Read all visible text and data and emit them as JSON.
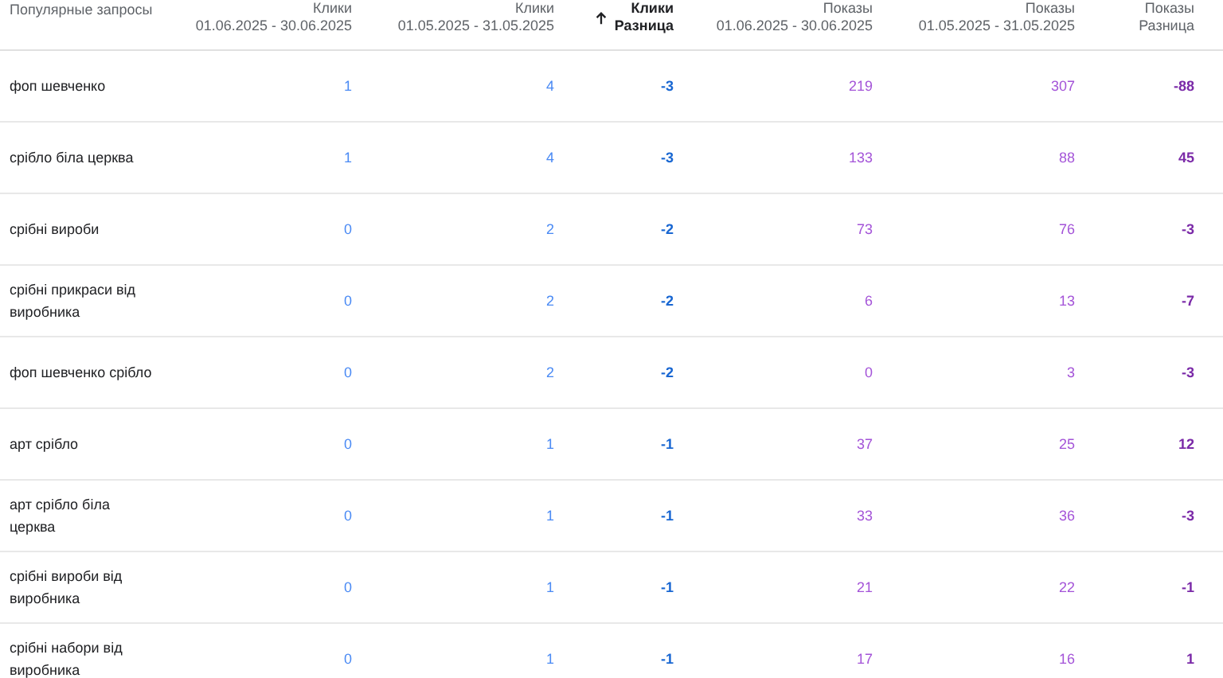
{
  "table": {
    "query_heading": "Популярные запросы",
    "columns": [
      {
        "metric": "Клики",
        "period": "01.06.2025 - 30.06.2025",
        "kind": "clicks",
        "sorted": false
      },
      {
        "metric": "Клики",
        "period": "01.05.2025 - 31.05.2025",
        "kind": "clicks",
        "sorted": false
      },
      {
        "metric": "Клики",
        "period": "Разница",
        "kind": "clicks_diff",
        "sorted": true
      },
      {
        "metric": "Показы",
        "period": "01.06.2025 - 30.06.2025",
        "kind": "impressions",
        "sorted": false
      },
      {
        "metric": "Показы",
        "period": "01.05.2025 - 31.05.2025",
        "kind": "impressions",
        "sorted": false
      },
      {
        "metric": "Показы",
        "period": "Разница",
        "kind": "impressions_diff",
        "sorted": false
      }
    ],
    "rows": [
      {
        "query": "фоп шевченко",
        "values": [
          "1",
          "4",
          "-3",
          "219",
          "307",
          "-88"
        ]
      },
      {
        "query": "срібло біла церква",
        "values": [
          "1",
          "4",
          "-3",
          "133",
          "88",
          "45"
        ]
      },
      {
        "query": "срібні вироби",
        "values": [
          "0",
          "2",
          "-2",
          "73",
          "76",
          "-3"
        ]
      },
      {
        "query": "срібні прикраси від виробника",
        "values": [
          "0",
          "2",
          "-2",
          "6",
          "13",
          "-7"
        ]
      },
      {
        "query": "фоп шевченко срібло",
        "values": [
          "0",
          "2",
          "-2",
          "0",
          "3",
          "-3"
        ]
      },
      {
        "query": "арт срібло",
        "values": [
          "0",
          "1",
          "-1",
          "37",
          "25",
          "12"
        ]
      },
      {
        "query": "арт срібло біла церква",
        "values": [
          "0",
          "1",
          "-1",
          "33",
          "36",
          "-3"
        ]
      },
      {
        "query": "срібні вироби від виробника",
        "values": [
          "0",
          "1",
          "-1",
          "21",
          "22",
          "-1"
        ]
      },
      {
        "query": "срібні набори від виробника",
        "values": [
          "0",
          "1",
          "-1",
          "17",
          "16",
          "1"
        ]
      }
    ]
  }
}
